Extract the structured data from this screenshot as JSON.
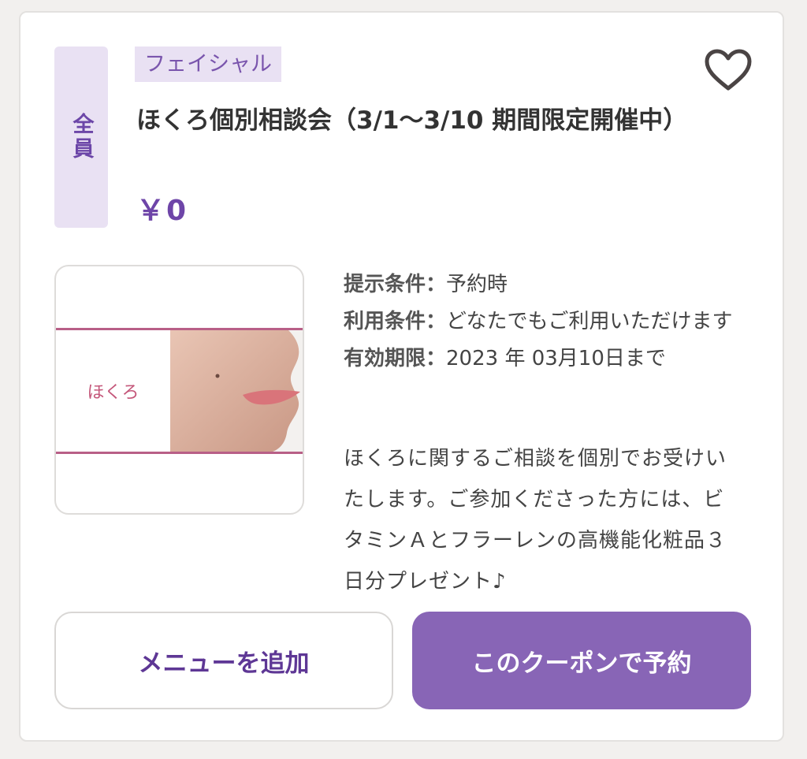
{
  "coupon": {
    "target": "全員",
    "category": "フェイシャル",
    "title": "ほくろ個別相談会（3/1〜3/10 期間限定開催中）",
    "price": "￥0",
    "image_label": "ほくろ",
    "conditions": [
      {
        "key": "提示条件",
        "value": "予約時"
      },
      {
        "key": "利用条件",
        "value": "どなたでもご利用いただけます"
      },
      {
        "key": "有効期限",
        "value": "2023 年 03月10日まで"
      }
    ],
    "separator": "：",
    "description": "ほくろに関するご相談を個別でお受けいたします。ご参加くださった方には、ビタミンＡとフラーレンの高機能化粧品３日分プレゼント♪"
  },
  "buttons": {
    "add_menu": "メニューを追加",
    "book": "このクーポンで予約"
  },
  "icons": {
    "favorite": "heart-outline-icon"
  },
  "colors": {
    "accent": "#8865b6",
    "accent_text": "#6e45a8",
    "badge_bg": "#e9e1f3",
    "image_border": "#b85f87"
  }
}
